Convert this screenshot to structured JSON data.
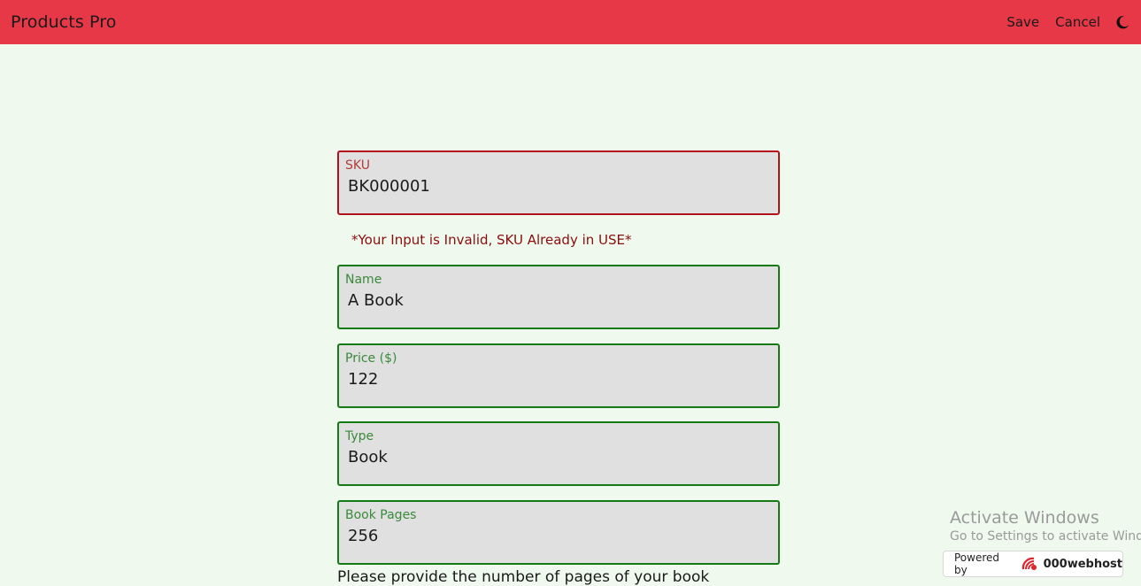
{
  "header": {
    "brand": "Products Pro",
    "save_label": "Save",
    "cancel_label": "Cancel",
    "theme_icon": "moon-icon"
  },
  "form": {
    "sku": {
      "label": "SKU",
      "value": "BK000001",
      "error": "*Your Input is Invalid, SKU Already in USE*"
    },
    "name": {
      "label": "Name",
      "value": "A Book"
    },
    "price": {
      "label": "Price ($)",
      "value": "122"
    },
    "type": {
      "label": "Type",
      "value": "Book"
    },
    "pages": {
      "label": "Book Pages",
      "value": "256"
    },
    "helper_text": "Please provide the number of pages of your book"
  },
  "watermark": {
    "title": "Activate Windows",
    "subtitle": "Go to Settings to activate Windows."
  },
  "badge": {
    "powered_label": "Powered by",
    "brand": "000webhost"
  },
  "colors": {
    "header_bg": "#e73847",
    "page_bg": "#eff9ee",
    "valid_border": "#157a16",
    "invalid_border": "#b3121d",
    "error_text": "#8a0e0e"
  }
}
